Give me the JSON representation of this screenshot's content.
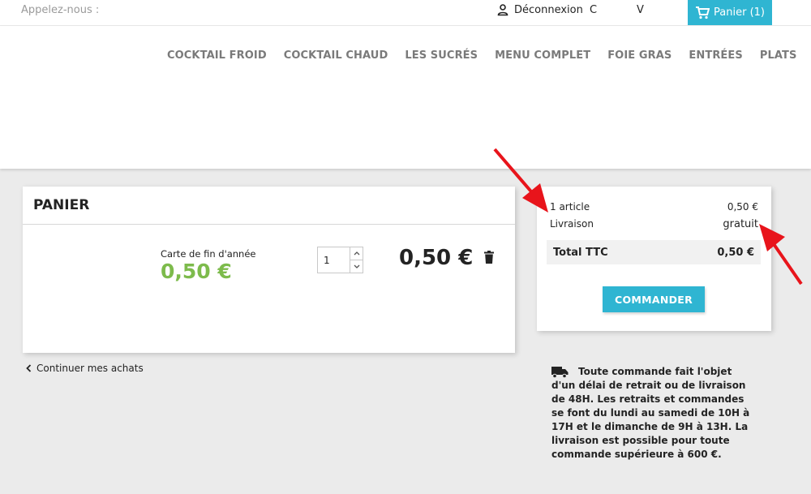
{
  "header": {
    "phone_label": "Appelez-nous :",
    "logout_label": "Déconnexion",
    "trunc_a": "C",
    "trunc_b": "V",
    "cart_label": "Panier (1)"
  },
  "nav": {
    "items": [
      "COCKTAIL FROID",
      "COCKTAIL CHAUD",
      "LES SUCRÉS",
      "MENU COMPLET",
      "FOIE GRAS",
      "ENTRÉES",
      "PLATS"
    ]
  },
  "cart": {
    "title": "PANIER",
    "item": {
      "name": "Carte de fin d'année",
      "unit_price": "0,50 €",
      "quantity": "1",
      "line_total": "0,50 €"
    },
    "continue_label": "Continuer mes achats"
  },
  "summary": {
    "articles_label": "1 article",
    "articles_value": "0,50 €",
    "shipping_label": "Livraison",
    "shipping_value": "gratuit",
    "total_label": "Total TTC",
    "total_value": "0,50 €",
    "order_button": "COMMANDER"
  },
  "notice": {
    "text": "Toute commande fait l'objet d'un délai de retrait ou de livraison de 48H. Les retraits et commandes se font du lundi au samedi de 10H à 17H et le dimanche de 9H à 13H. La livraison est possible pour toute commande supérieure à 600 €."
  },
  "colors": {
    "accent": "#2fb5d2",
    "price_green": "#7dbb4c",
    "annotation_red": "#e8141b"
  },
  "icons": [
    "user-icon",
    "cart-icon",
    "trash-icon",
    "chevron-left-icon",
    "truck-icon",
    "chevron-up-icon",
    "chevron-down-icon"
  ]
}
